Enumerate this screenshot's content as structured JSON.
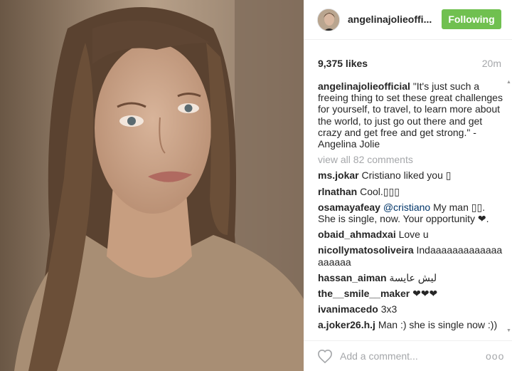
{
  "header": {
    "username": "angelinajolieoffi...",
    "follow_label": "Following"
  },
  "stats": {
    "likes": "9,375 likes",
    "time": "20m"
  },
  "caption": {
    "user": "angelinajolieofficial",
    "text": "\"It's just such a freeing thing to set these great challenges for yourself, to travel, to learn more about the world, to just go out there and get crazy and get free and get strong.\" - Angelina Jolie"
  },
  "view_all": "view all 82 comments",
  "comments": [
    {
      "user": "ms.jokar",
      "text": "Cristiano liked you ▯"
    },
    {
      "user": "rlnathan",
      "text": "Cool.▯▯▯"
    },
    {
      "user": "osamayafeay",
      "mention": "@cristiano",
      "text": "My man ▯▯. She is single, now. Your opportunity ❤."
    },
    {
      "user": "obaid_ahmadxai",
      "text": "Love u"
    },
    {
      "user": "nicollymatosoliveira",
      "text": "Indaaaaaaaaaaaaaaaaaaa"
    },
    {
      "user": "hassan_aiman",
      "text": "ليش عايسة"
    },
    {
      "user": "the__smile__maker",
      "text": "❤❤❤"
    },
    {
      "user": "ivanimacedo",
      "text": "3x3"
    },
    {
      "user": "a.joker26.h.j",
      "text": "Man :) she is single now :))"
    }
  ],
  "footer": {
    "add_comment_placeholder": "Add a comment...",
    "more_label": "ooo"
  },
  "colors": {
    "follow_green": "#70c050",
    "muted_gray": "#a5a7aa",
    "mention_blue": "#003569"
  },
  "icons": {
    "like": "heart-icon",
    "more": "more-options-icon"
  }
}
